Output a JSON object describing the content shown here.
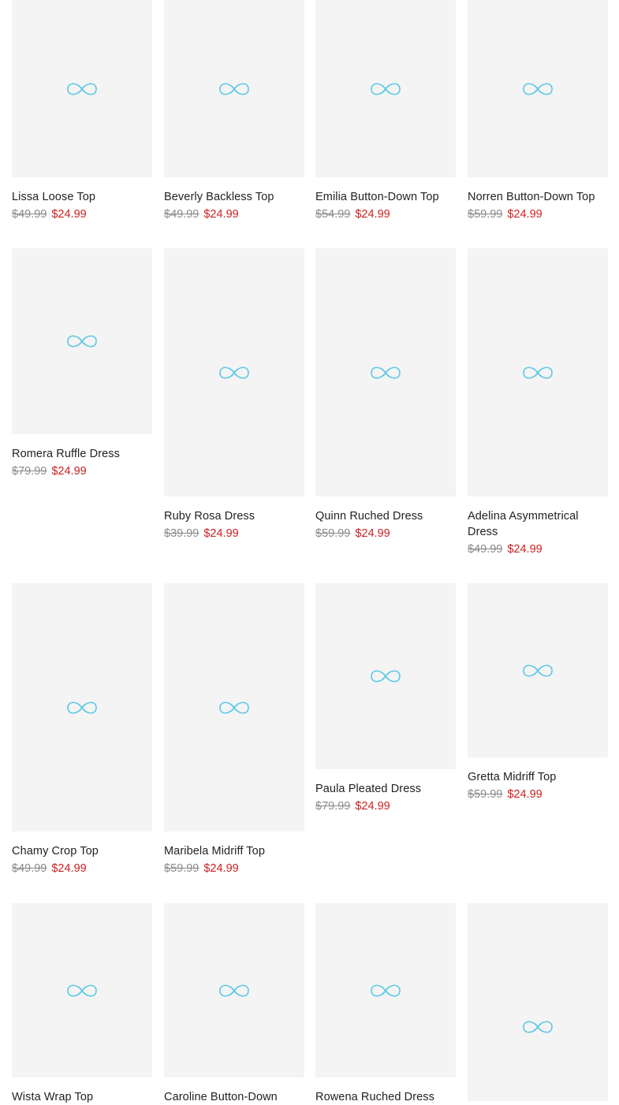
{
  "products": [
    {
      "name": "Lissa Loose Top",
      "old_price": "$49.99",
      "price": "$24.99"
    },
    {
      "name": "Beverly Backless Top",
      "old_price": "$49.99",
      "price": "$24.99"
    },
    {
      "name": "Emilia Button-Down Top",
      "old_price": "$54.99",
      "price": "$24.99"
    },
    {
      "name": "Norren Button-Down Top",
      "old_price": "$59.99",
      "price": "$24.99"
    },
    {
      "name": "Romera Ruffle Dress",
      "old_price": "$79.99",
      "price": "$24.99"
    },
    {
      "name": "Ruby Rosa Dress",
      "old_price": "$39.99",
      "price": "$24.99"
    },
    {
      "name": "Quinn Ruched Dress",
      "old_price": "$59.99",
      "price": "$24.99"
    },
    {
      "name": "Adelina Asymmetrical Dress",
      "old_price": "$49.99",
      "price": "$24.99"
    },
    {
      "name": "Chamy Crop Top",
      "old_price": "$49.99",
      "price": "$24.99"
    },
    {
      "name": "Maribela Midriff Top",
      "old_price": "$59.99",
      "price": "$24.99"
    },
    {
      "name": "Paula Pleated Dress",
      "old_price": "$79.99",
      "price": "$24.99"
    },
    {
      "name": "Gretta Midriff Top",
      "old_price": "$59.99",
      "price": "$24.99"
    },
    {
      "name": "Wista Wrap Top",
      "old_price": "",
      "price": ""
    },
    {
      "name": "Caroline Button-Down",
      "old_price": "",
      "price": ""
    },
    {
      "name": "Rowena Ruched Dress",
      "old_price": "",
      "price": ""
    },
    {
      "name": "",
      "old_price": "",
      "price": ""
    }
  ],
  "placeholder_icon": "loading-infinity-icon",
  "colors": {
    "placeholder_bg": "#f4f4f4",
    "loader": "#5bc8e6",
    "sale": "#cc1f1f",
    "strikethrough": "#8a8a8a"
  }
}
